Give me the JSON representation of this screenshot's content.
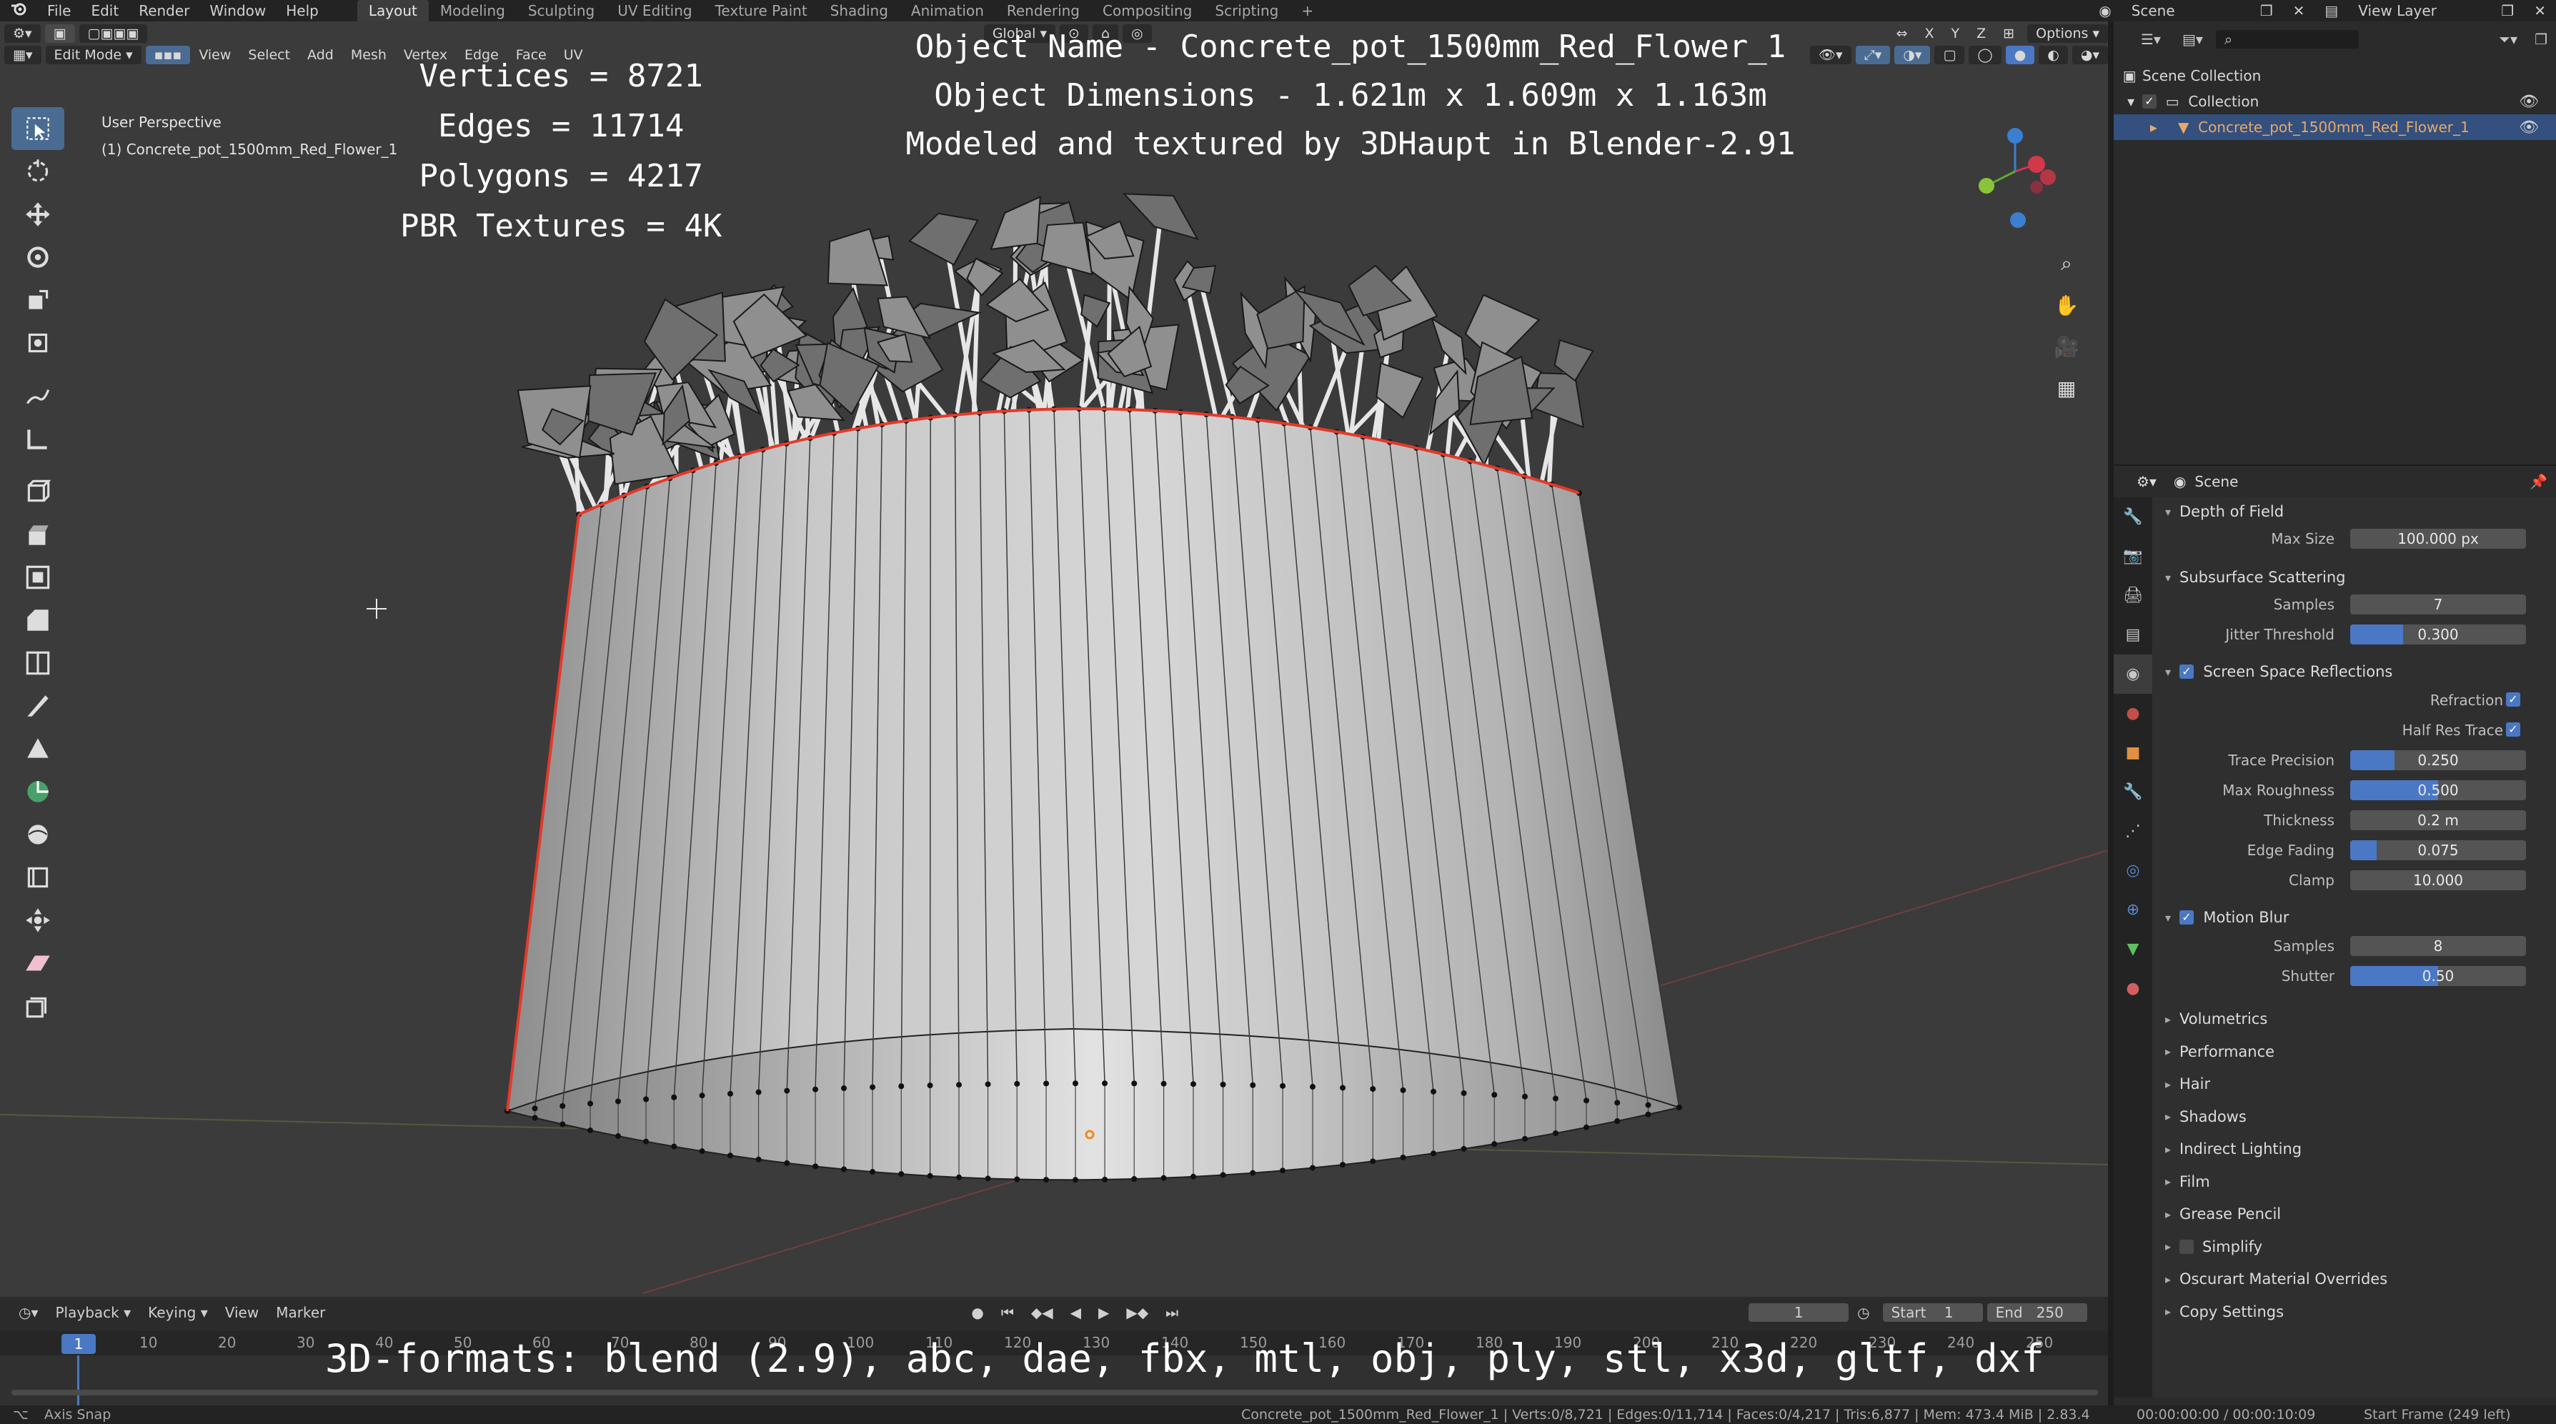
{
  "topbar": {
    "menus": [
      "File",
      "Edit",
      "Render",
      "Window",
      "Help"
    ],
    "workspaces": [
      "Layout",
      "Modeling",
      "Sculpting",
      "UV Editing",
      "Texture Paint",
      "Shading",
      "Animation",
      "Rendering",
      "Compositing",
      "Scripting"
    ],
    "active_workspace": "Layout",
    "scene": "Scene",
    "view_layer": "View Layer"
  },
  "viewport": {
    "mode": "Edit Mode",
    "menus": [
      "View",
      "Select",
      "Add",
      "Mesh",
      "Vertex",
      "Edge",
      "Face",
      "UV"
    ],
    "orientation": "Global",
    "options_label": "Options",
    "axis_buttons": [
      "X",
      "Y",
      "Z"
    ],
    "perspective": "User Perspective",
    "object_line": "(1) Concrete_pot_1500mm_Red_Flower_1"
  },
  "overlay": {
    "object_name": "Object Name - Concrete_pot_1500mm_Red_Flower_1",
    "dimensions": "Object Dimensions -  1.621m x 1.609m x 1.163m",
    "credit": "Modeled and textured by 3DHaupt in Blender-2.91",
    "vertices": "Vertices = 8721",
    "edges": "Edges = 11714",
    "polygons": "Polygons = 4217",
    "textures": "PBR Textures = 4K",
    "formats": "3D-formats: blend (2.9), abc, dae, fbx, mtl, obj, ply, stl, x3d, gltf, dxf"
  },
  "timeline": {
    "menus": [
      "Playback",
      "Keying",
      "View",
      "Marker"
    ],
    "current_frame": "1",
    "start_label": "Start",
    "start_value": "1",
    "end_label": "End",
    "end_value": "250",
    "ticks": [
      "10",
      "20",
      "30",
      "40",
      "50",
      "60",
      "70",
      "80",
      "90",
      "100",
      "110",
      "120",
      "130",
      "140",
      "150",
      "160",
      "170",
      "180",
      "190",
      "200",
      "210",
      "220",
      "230",
      "240",
      "250"
    ]
  },
  "statusbar": {
    "left": "Axis Snap",
    "center": "Concrete_pot_1500mm_Red_Flower_1 | Verts:0/8,721 | Edges:0/11,714 | Faces:0/4,217 | Tris:6,877 | Mem: 473.4 MiB | 2.83.4",
    "time": "00:00:00:00 / 00:00:10:09",
    "frame": "Start Frame (249 left)"
  },
  "outliner": {
    "scene_collection": "Scene Collection",
    "collection": "Collection",
    "object": "Concrete_pot_1500mm_Red_Flower_1"
  },
  "properties": {
    "context": "Scene",
    "depth_of_field": {
      "title": "Depth of Field",
      "max_size_label": "Max Size",
      "max_size": "100.000 px"
    },
    "sss": {
      "title": "Subsurface Scattering",
      "samples_label": "Samples",
      "samples": "7",
      "jitter_label": "Jitter Threshold",
      "jitter": "0.300",
      "jitter_fraction": 0.3
    },
    "ssr": {
      "title": "Screen Space Reflections",
      "refraction_label": "Refraction",
      "half_res_label": "Half Res Trace",
      "trace_label": "Trace Precision",
      "trace": "0.250",
      "trace_fraction": 0.25,
      "roughness_label": "Max Roughness",
      "roughness": "0.500",
      "roughness_fraction": 0.5,
      "thickness_label": "Thickness",
      "thickness": "0.2 m",
      "fading_label": "Edge Fading",
      "fading": "0.075",
      "fading_fraction": 0.15,
      "clamp_label": "Clamp",
      "clamp": "10.000"
    },
    "motion_blur": {
      "title": "Motion Blur",
      "samples_label": "Samples",
      "samples": "8",
      "shutter_label": "Shutter",
      "shutter": "0.50",
      "shutter_fraction": 0.5
    },
    "collapsed_panels": [
      "Volumetrics",
      "Performance",
      "Hair",
      "Shadows",
      "Indirect Lighting",
      "Film",
      "Grease Pencil",
      "Simplify",
      "Oscurart Material Overrides",
      "Copy Settings"
    ]
  },
  "colors": {
    "accent": "#4a78c4",
    "selection_edge": "#e33a2a",
    "viewport_bg": "#3b3b3b",
    "panel_bg": "#2b2b2b"
  }
}
